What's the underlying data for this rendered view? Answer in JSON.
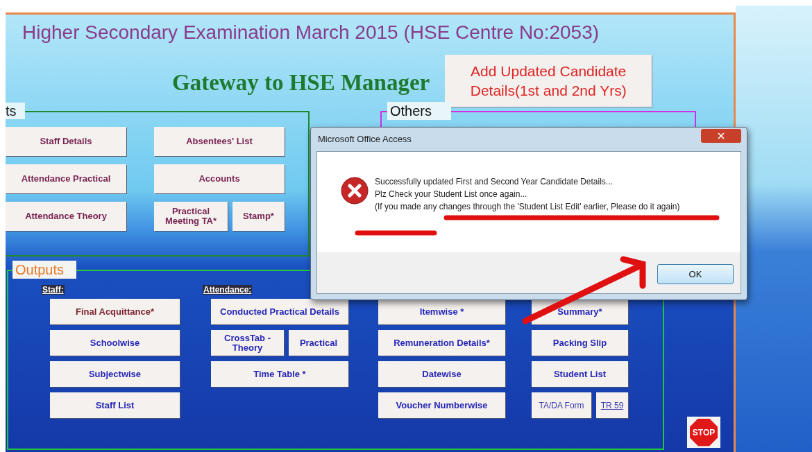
{
  "form": {
    "title": "Higher Secondary Examination March 2015 (HSE Centre No:2053)",
    "heading": "Gateway to HSE Manager",
    "update_button": "Add Updated Candidate Details(1st and 2nd Yrs)"
  },
  "inputs_section": {
    "label": "ts",
    "columns": [
      [
        [
          {
            "label": "Staff Details",
            "kind": "button"
          }
        ],
        [
          {
            "label": "Attendance Practical",
            "kind": "button"
          }
        ],
        [
          {
            "label": "Attendance  Theory",
            "kind": "button"
          }
        ]
      ],
      [
        [
          {
            "label": "Absentees' List",
            "kind": "button"
          }
        ],
        [
          {
            "label": "Accounts",
            "kind": "button"
          }
        ],
        [
          {
            "label": "Practical Meeting TA*",
            "kind": "button"
          },
          {
            "label": "Stamp*",
            "kind": "button"
          }
        ]
      ]
    ]
  },
  "others_section": {
    "label": "Others"
  },
  "outputs_section": {
    "label": "Outputs",
    "columns": [
      {
        "header": "Staff:",
        "rows": [
          [
            {
              "label": "Final Acquittance*",
              "kind": "emphasis"
            }
          ],
          [
            {
              "label": "Schoolwise",
              "kind": "button"
            }
          ],
          [
            {
              "label": "Subjectwise",
              "kind": "button"
            }
          ],
          [
            {
              "label": "Staff List",
              "kind": "button"
            }
          ]
        ]
      },
      {
        "header": "Attendance:",
        "rows": [
          [
            {
              "label": "Conducted Practical Details",
              "kind": "button"
            }
          ],
          [
            {
              "label": "CrossTab - Theory",
              "kind": "button"
            },
            {
              "label": "Practical",
              "kind": "button"
            }
          ],
          [
            {
              "label": "Time Table *",
              "kind": "button"
            }
          ]
        ]
      },
      {
        "rows": [
          [
            {
              "label": "Itemwise *",
              "kind": "button"
            }
          ],
          [
            {
              "label": "Remuneration Details*",
              "kind": "button"
            }
          ],
          [
            {
              "label": "Datewise",
              "kind": "button"
            }
          ],
          [
            {
              "label": "Voucher Numberwise",
              "kind": "button"
            }
          ]
        ]
      },
      {
        "rows": [
          [
            {
              "label": "Summary*",
              "kind": "button"
            }
          ],
          [
            {
              "label": "Packing Slip",
              "kind": "button"
            }
          ],
          [
            {
              "label": "Student List",
              "kind": "button"
            }
          ],
          [
            {
              "label": "TA/DA Form",
              "kind": "plain"
            },
            {
              "label": "TR 59",
              "kind": "link"
            }
          ]
        ]
      }
    ]
  },
  "stop_button": "STOP",
  "dialog": {
    "title": "Microsoft Office Access",
    "messages": [
      "Successfully updated First and Second Year Candidate Details...",
      "Plz Check your Student List once again...",
      "(If you made any changes through the 'Student List Edit' earlier, Please do it again)"
    ],
    "button": "OK"
  }
}
